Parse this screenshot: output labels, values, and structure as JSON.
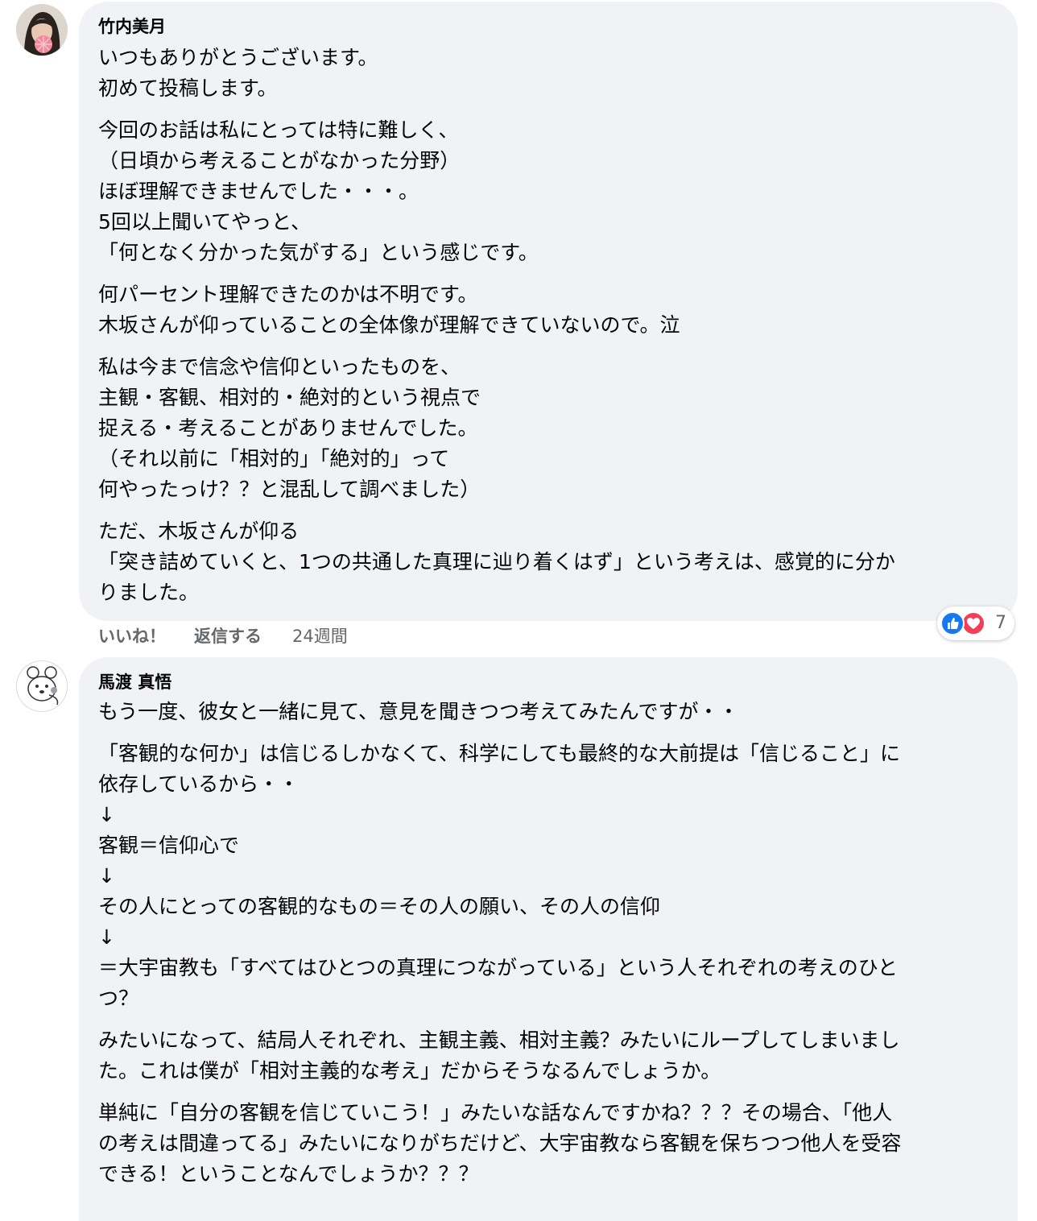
{
  "comments": [
    {
      "author": "竹内美月",
      "paragraphs": [
        [
          "いつもありがとうございます。",
          "初めて投稿します。"
        ],
        [
          "今回のお話は私にとっては特に難しく、",
          "（日頃から考えることがなかった分野）",
          "ほぼ理解できませんでした・・・。",
          "5回以上聞いてやっと、",
          "「何となく分かった気がする」という感じです。"
        ],
        [
          "何パーセント理解できたのかは不明です。",
          "木坂さんが仰っていることの全体像が理解できていないので。泣"
        ],
        [
          "私は今まで信念や信仰といったものを、",
          "主観・客観、相対的・絶対的という視点で",
          "捉える・考えることがありませんでした。",
          "（それ以前に「相対的」「絶対的」って",
          "何やったっけ？？と混乱して調べました）"
        ],
        [
          "ただ、木坂さんが仰る",
          "「突き詰めていくと、1つの共通した真理に辿り着くはず」という考えは、感覚的に分か",
          "りました。"
        ]
      ],
      "actions": {
        "like": "いいね！",
        "reply": "返信する",
        "time": "24週間"
      },
      "reactions": {
        "icons": [
          "like-icon",
          "love-icon"
        ],
        "count": "7"
      }
    },
    {
      "author": "馬渡 真悟",
      "paragraphs": [
        [
          "もう一度、彼女と一緒に見て、意見を聞きつつ考えてみたんですが・・"
        ],
        [
          "「客観的な何か」は信じるしかなくて、科学にしても最終的な大前提は「信じること」に",
          "依存しているから・・",
          "↓",
          "客観＝信仰心で",
          "↓",
          "その人にとっての客観的なもの＝その人の願い、その人の信仰",
          "↓",
          "＝大宇宙教も「すべてはひとつの真理につながっている」という人それぞれの考えのひと",
          "つ？"
        ],
        [
          "みたいになって、結局人それぞれ、主観主義、相対主義？みたいにループしてしまいまし",
          "た。これは僕が「相対主義的な考え」だからそうなるんでしょうか。"
        ],
        [
          "単純に「自分の客観を信じていこう！」みたいな話なんですかね？？？その場合、「他人",
          "の考えは間違ってる」みたいになりがちだけど、大宇宙教なら客観を保ちつつ他人を受容",
          "できる！ということなんでしょうか？？？"
        ]
      ]
    }
  ],
  "colors": {
    "bubble": "#f0f2f5",
    "meta_text": "#65676b",
    "like": "#1877f2",
    "love": "#f33e58"
  }
}
